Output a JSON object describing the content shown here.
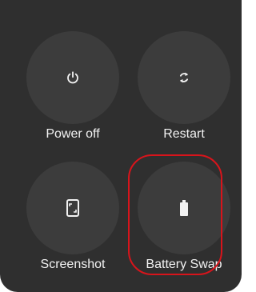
{
  "colors": {
    "panel_bg": "#2f2f2f",
    "button_bg": "#3c3c3c",
    "text": "#f2f2f2",
    "highlight": "#d8141b"
  },
  "buttons": [
    {
      "label": "Power off",
      "icon": "power-icon"
    },
    {
      "label": "Restart",
      "icon": "restart-icon"
    },
    {
      "label": "Screenshot",
      "icon": "screenshot-icon"
    },
    {
      "label": "Battery Swap",
      "icon": "battery-icon"
    }
  ]
}
